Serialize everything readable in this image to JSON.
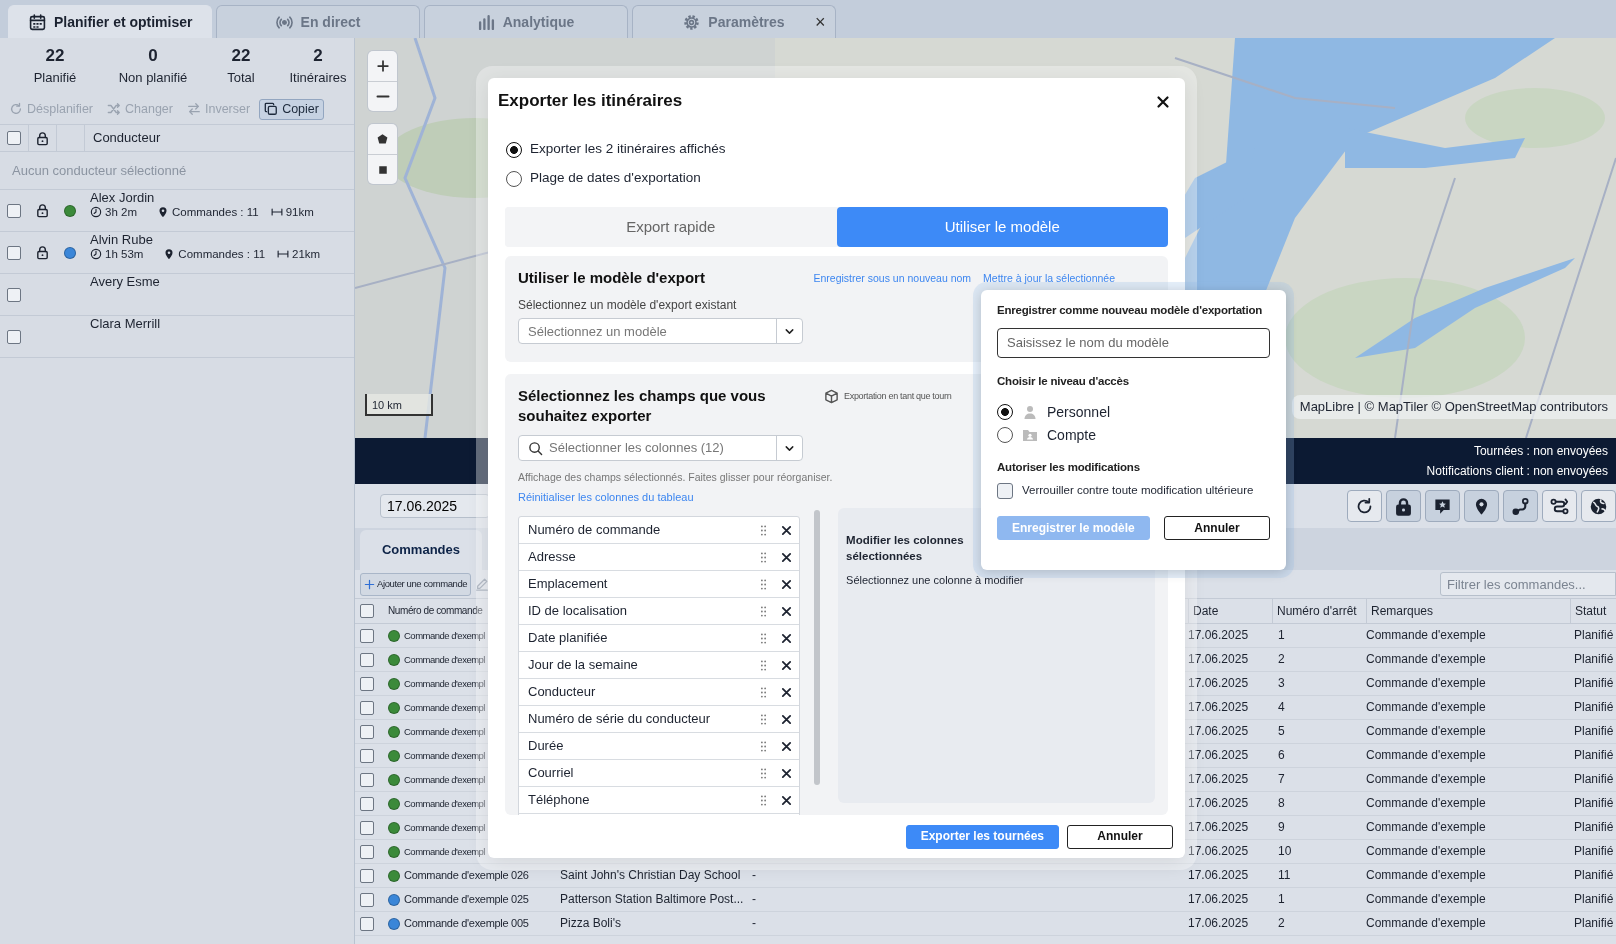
{
  "tabs": [
    {
      "label": "Planifier et optimiser",
      "selected": true
    },
    {
      "label": "En direct",
      "selected": false
    },
    {
      "label": "Analytique",
      "selected": false
    },
    {
      "label": "Paramètres",
      "selected": false,
      "close": "×"
    }
  ],
  "summary": [
    {
      "value": "22",
      "label": "Planifié"
    },
    {
      "value": "0",
      "label": "Non planifié"
    },
    {
      "value": "22",
      "label": "Total"
    },
    {
      "value": "2",
      "label": "Itinéraires"
    }
  ],
  "actions": [
    {
      "label": "Désplanifier",
      "disabled": true
    },
    {
      "label": "Changer",
      "disabled": true
    },
    {
      "label": "Inverser",
      "disabled": true
    },
    {
      "label": "Copier",
      "disabled": false
    }
  ],
  "drivers": {
    "header": "Conducteur",
    "header_checked": false,
    "empty_text": "Aucun conducteur sélectionné",
    "rows": [
      {
        "name": "Alex Jordin",
        "checked": false,
        "color": "#3b8a3a",
        "duration": "3h 2m",
        "orders": "Commandes : 11",
        "distance": "91km"
      },
      {
        "name": "Alvin Rube",
        "checked": false,
        "color": "#3a86d8",
        "duration": "1h 53m",
        "orders": "Commandes : 11",
        "distance": "21km"
      },
      {
        "name": "Avery Esme",
        "checked": false
      },
      {
        "name": "Clara Merrill",
        "checked": false
      }
    ]
  },
  "map": {
    "scale": "10 km",
    "attribution": "MapLibre | © MapTiler © OpenStreetMap contributors"
  },
  "status_bar": [
    "Tournées : non envoyées",
    "Notifications client : non envoyées"
  ],
  "date": "17.06.2025",
  "orders_tab": {
    "label": "Commandes",
    "selected": true
  },
  "add_button": "Ajouter une commande",
  "filter": {
    "placeholder": "Filtrer les commandes..."
  },
  "orders_table": {
    "header_checked": false,
    "columns": [
      "Numéro de commande",
      "Date",
      "Numéro d'arrêt",
      "Remarques",
      "Statut"
    ],
    "rows": [
      {
        "checked": false,
        "color": "#3b8a3a",
        "order": "Commande d'exempl",
        "date": "17.06.2025",
        "stop": "1",
        "remark": "Commande d'exemple",
        "status": "Planifié"
      },
      {
        "checked": false,
        "color": "#3b8a3a",
        "order": "Commande d'exempl",
        "date": "17.06.2025",
        "stop": "2",
        "remark": "Commande d'exemple",
        "status": "Planifié"
      },
      {
        "checked": false,
        "color": "#3b8a3a",
        "order": "Commande d'exempl",
        "date": "17.06.2025",
        "stop": "3",
        "remark": "Commande d'exemple",
        "status": "Planifié"
      },
      {
        "checked": false,
        "color": "#3b8a3a",
        "order": "Commande d'exempl",
        "date": "17.06.2025",
        "stop": "4",
        "remark": "Commande d'exemple",
        "status": "Planifié"
      },
      {
        "checked": false,
        "color": "#3b8a3a",
        "order": "Commande d'exempl",
        "date": "17.06.2025",
        "stop": "5",
        "remark": "Commande d'exemple",
        "status": "Planifié"
      },
      {
        "checked": false,
        "color": "#3b8a3a",
        "order": "Commande d'exempl",
        "date": "17.06.2025",
        "stop": "6",
        "remark": "Commande d'exemple",
        "status": "Planifié"
      },
      {
        "checked": false,
        "color": "#3b8a3a",
        "order": "Commande d'exempl",
        "date": "17.06.2025",
        "stop": "7",
        "remark": "Commande d'exemple",
        "status": "Planifié"
      },
      {
        "checked": false,
        "color": "#3b8a3a",
        "order": "Commande d'exempl",
        "date": "17.06.2025",
        "stop": "8",
        "remark": "Commande d'exemple",
        "status": "Planifié"
      },
      {
        "checked": false,
        "color": "#3b8a3a",
        "order": "Commande d'exempl",
        "date": "17.06.2025",
        "stop": "9",
        "remark": "Commande d'exemple",
        "status": "Planifié"
      },
      {
        "checked": false,
        "color": "#3b8a3a",
        "order": "Commande d'exempl",
        "date": "17.06.2025",
        "stop": "10",
        "remark": "Commande d'exemple",
        "status": "Planifié"
      },
      {
        "checked": false,
        "color": "#3b8a3a",
        "order": "Commande d'exemple 026",
        "address": "Saint John's Christian Day School",
        "column_3": "-",
        "date": "17.06.2025",
        "stop": "11",
        "remark": "Commande d'exemple",
        "status": "Planifié"
      },
      {
        "checked": false,
        "color": "#3a86d8",
        "order": "Commande d'exemple 025",
        "address": "Patterson Station Baltimore Post...",
        "column_3": "-",
        "date": "17.06.2025",
        "stop": "1",
        "remark": "Commande d'exemple",
        "status": "Planifié"
      },
      {
        "checked": false,
        "color": "#3a86d8",
        "order": "Commande d'exemple 005",
        "address": "Pizza Boli's",
        "column_3": "-",
        "date": "17.06.2025",
        "stop": "2",
        "remark": "Commande d'exemple",
        "status": "Planifié"
      }
    ]
  },
  "export_dialog": {
    "title": "Exporter les itinéraires",
    "scope_options": [
      {
        "label": "Exporter les 2 itinéraires affichés",
        "selected": true
      },
      {
        "label": "Plage de dates d'exportation",
        "selected": false
      }
    ],
    "modes": [
      {
        "label": "Export rapide",
        "selected": false
      },
      {
        "label": "Utiliser le modèle",
        "selected": true
      }
    ],
    "template_section": {
      "title": "Utiliser le modèle d'export",
      "links": [
        "Enregistrer sous un nouveau nom",
        "Mettre à jour la sélectionnée"
      ],
      "label": "Sélectionnez un modèle d'export existant",
      "select": {
        "placeholder": "Sélectionnez un modèle"
      }
    },
    "fields_section": {
      "title": "Sélectionnez les champs que vous souhaitez exporter",
      "export_as": "Exportation en tant que tourn",
      "search": {
        "placeholder": "Sélectionner les colonnes (12)"
      },
      "hint": "Affichage des champs sélectionnés. Faites glisser pour réorganiser.",
      "reset_link": "Réinitialiser les colonnes du tableau",
      "fields": [
        "Numéro de commande",
        "Adresse",
        "Emplacement",
        "ID de localisation",
        "Date planifiée",
        "Jour de la semaine",
        "Conducteur",
        "Numéro de série du conducteur",
        "Durée",
        "Courriel",
        "Téléphone"
      ],
      "editor": {
        "title": "Modifier les colonnes sélectionnées",
        "hint": "Sélectionnez une colonne à modifier"
      }
    },
    "buttons": [
      {
        "label": "Exporter les tournées",
        "kind": "primary"
      },
      {
        "label": "Annuler",
        "kind": "secondary"
      }
    ]
  },
  "save_popover": {
    "title": "Enregistrer comme nouveau modèle d'exportation",
    "name_field": {
      "placeholder": "Saisissez le nom du modèle"
    },
    "access_title": "Choisir le niveau d'accès",
    "access_options": [
      {
        "label": "Personnel",
        "selected": true
      },
      {
        "label": "Compte",
        "selected": false
      }
    ],
    "permissions_title": "Autoriser les modifications",
    "lock_option": {
      "label": "Verrouiller contre toute modification ultérieure",
      "checked": false
    },
    "buttons": [
      {
        "label": "Enregistrer le modèle",
        "kind": "primary",
        "disabled": true
      },
      {
        "label": "Annuler",
        "kind": "secondary",
        "disabled": false
      }
    ]
  }
}
